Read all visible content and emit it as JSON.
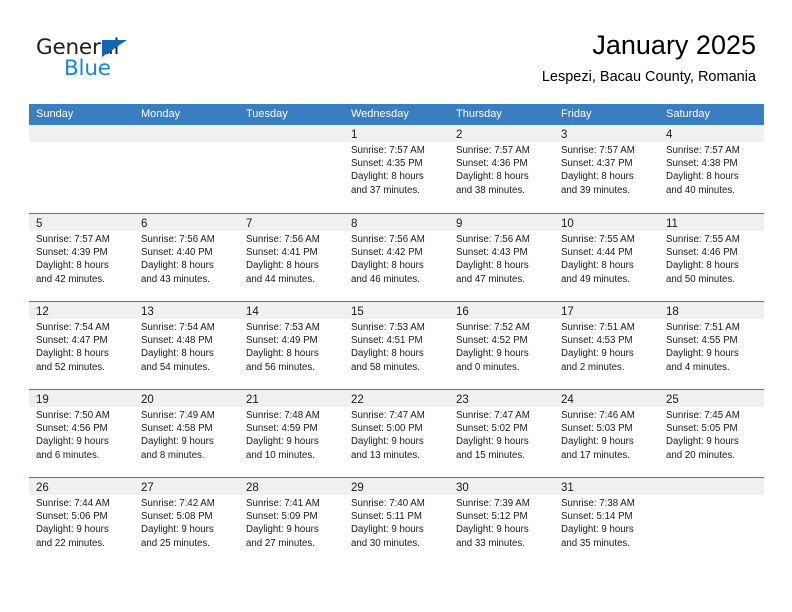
{
  "brand": {
    "name_part1": "General",
    "name_part2": "Blue",
    "accent_color": "#1787d6",
    "triangle_color": "#1267b1"
  },
  "header": {
    "title": "January 2025",
    "subtitle": "Lespezi, Bacau County, Romania"
  },
  "calendar": {
    "header_color": "#3a7dc0",
    "daynum_band_color": "#f0f0f0",
    "weekday_headers": [
      "Sunday",
      "Monday",
      "Tuesday",
      "Wednesday",
      "Thursday",
      "Friday",
      "Saturday"
    ],
    "weeks": [
      [
        {
          "day": "",
          "empty": true,
          "lines": []
        },
        {
          "day": "",
          "empty": true,
          "lines": []
        },
        {
          "day": "",
          "empty": true,
          "lines": []
        },
        {
          "day": "1",
          "empty": false,
          "lines": [
            "Sunrise: 7:57 AM",
            "Sunset: 4:35 PM",
            "Daylight: 8 hours",
            "and 37 minutes."
          ]
        },
        {
          "day": "2",
          "empty": false,
          "lines": [
            "Sunrise: 7:57 AM",
            "Sunset: 4:36 PM",
            "Daylight: 8 hours",
            "and 38 minutes."
          ]
        },
        {
          "day": "3",
          "empty": false,
          "lines": [
            "Sunrise: 7:57 AM",
            "Sunset: 4:37 PM",
            "Daylight: 8 hours",
            "and 39 minutes."
          ]
        },
        {
          "day": "4",
          "empty": false,
          "lines": [
            "Sunrise: 7:57 AM",
            "Sunset: 4:38 PM",
            "Daylight: 8 hours",
            "and 40 minutes."
          ]
        }
      ],
      [
        {
          "day": "5",
          "empty": false,
          "lines": [
            "Sunrise: 7:57 AM",
            "Sunset: 4:39 PM",
            "Daylight: 8 hours",
            "and 42 minutes."
          ]
        },
        {
          "day": "6",
          "empty": false,
          "lines": [
            "Sunrise: 7:56 AM",
            "Sunset: 4:40 PM",
            "Daylight: 8 hours",
            "and 43 minutes."
          ]
        },
        {
          "day": "7",
          "empty": false,
          "lines": [
            "Sunrise: 7:56 AM",
            "Sunset: 4:41 PM",
            "Daylight: 8 hours",
            "and 44 minutes."
          ]
        },
        {
          "day": "8",
          "empty": false,
          "lines": [
            "Sunrise: 7:56 AM",
            "Sunset: 4:42 PM",
            "Daylight: 8 hours",
            "and 46 minutes."
          ]
        },
        {
          "day": "9",
          "empty": false,
          "lines": [
            "Sunrise: 7:56 AM",
            "Sunset: 4:43 PM",
            "Daylight: 8 hours",
            "and 47 minutes."
          ]
        },
        {
          "day": "10",
          "empty": false,
          "lines": [
            "Sunrise: 7:55 AM",
            "Sunset: 4:44 PM",
            "Daylight: 8 hours",
            "and 49 minutes."
          ]
        },
        {
          "day": "11",
          "empty": false,
          "lines": [
            "Sunrise: 7:55 AM",
            "Sunset: 4:46 PM",
            "Daylight: 8 hours",
            "and 50 minutes."
          ]
        }
      ],
      [
        {
          "day": "12",
          "empty": false,
          "lines": [
            "Sunrise: 7:54 AM",
            "Sunset: 4:47 PM",
            "Daylight: 8 hours",
            "and 52 minutes."
          ]
        },
        {
          "day": "13",
          "empty": false,
          "lines": [
            "Sunrise: 7:54 AM",
            "Sunset: 4:48 PM",
            "Daylight: 8 hours",
            "and 54 minutes."
          ]
        },
        {
          "day": "14",
          "empty": false,
          "lines": [
            "Sunrise: 7:53 AM",
            "Sunset: 4:49 PM",
            "Daylight: 8 hours",
            "and 56 minutes."
          ]
        },
        {
          "day": "15",
          "empty": false,
          "lines": [
            "Sunrise: 7:53 AM",
            "Sunset: 4:51 PM",
            "Daylight: 8 hours",
            "and 58 minutes."
          ]
        },
        {
          "day": "16",
          "empty": false,
          "lines": [
            "Sunrise: 7:52 AM",
            "Sunset: 4:52 PM",
            "Daylight: 9 hours",
            "and 0 minutes."
          ]
        },
        {
          "day": "17",
          "empty": false,
          "lines": [
            "Sunrise: 7:51 AM",
            "Sunset: 4:53 PM",
            "Daylight: 9 hours",
            "and 2 minutes."
          ]
        },
        {
          "day": "18",
          "empty": false,
          "lines": [
            "Sunrise: 7:51 AM",
            "Sunset: 4:55 PM",
            "Daylight: 9 hours",
            "and 4 minutes."
          ]
        }
      ],
      [
        {
          "day": "19",
          "empty": false,
          "lines": [
            "Sunrise: 7:50 AM",
            "Sunset: 4:56 PM",
            "Daylight: 9 hours",
            "and 6 minutes."
          ]
        },
        {
          "day": "20",
          "empty": false,
          "lines": [
            "Sunrise: 7:49 AM",
            "Sunset: 4:58 PM",
            "Daylight: 9 hours",
            "and 8 minutes."
          ]
        },
        {
          "day": "21",
          "empty": false,
          "lines": [
            "Sunrise: 7:48 AM",
            "Sunset: 4:59 PM",
            "Daylight: 9 hours",
            "and 10 minutes."
          ]
        },
        {
          "day": "22",
          "empty": false,
          "lines": [
            "Sunrise: 7:47 AM",
            "Sunset: 5:00 PM",
            "Daylight: 9 hours",
            "and 13 minutes."
          ]
        },
        {
          "day": "23",
          "empty": false,
          "lines": [
            "Sunrise: 7:47 AM",
            "Sunset: 5:02 PM",
            "Daylight: 9 hours",
            "and 15 minutes."
          ]
        },
        {
          "day": "24",
          "empty": false,
          "lines": [
            "Sunrise: 7:46 AM",
            "Sunset: 5:03 PM",
            "Daylight: 9 hours",
            "and 17 minutes."
          ]
        },
        {
          "day": "25",
          "empty": false,
          "lines": [
            "Sunrise: 7:45 AM",
            "Sunset: 5:05 PM",
            "Daylight: 9 hours",
            "and 20 minutes."
          ]
        }
      ],
      [
        {
          "day": "26",
          "empty": false,
          "lines": [
            "Sunrise: 7:44 AM",
            "Sunset: 5:06 PM",
            "Daylight: 9 hours",
            "and 22 minutes."
          ]
        },
        {
          "day": "27",
          "empty": false,
          "lines": [
            "Sunrise: 7:42 AM",
            "Sunset: 5:08 PM",
            "Daylight: 9 hours",
            "and 25 minutes."
          ]
        },
        {
          "day": "28",
          "empty": false,
          "lines": [
            "Sunrise: 7:41 AM",
            "Sunset: 5:09 PM",
            "Daylight: 9 hours",
            "and 27 minutes."
          ]
        },
        {
          "day": "29",
          "empty": false,
          "lines": [
            "Sunrise: 7:40 AM",
            "Sunset: 5:11 PM",
            "Daylight: 9 hours",
            "and 30 minutes."
          ]
        },
        {
          "day": "30",
          "empty": false,
          "lines": [
            "Sunrise: 7:39 AM",
            "Sunset: 5:12 PM",
            "Daylight: 9 hours",
            "and 33 minutes."
          ]
        },
        {
          "day": "31",
          "empty": false,
          "lines": [
            "Sunrise: 7:38 AM",
            "Sunset: 5:14 PM",
            "Daylight: 9 hours",
            "and 35 minutes."
          ]
        },
        {
          "day": "",
          "empty": true,
          "lines": []
        }
      ]
    ]
  }
}
